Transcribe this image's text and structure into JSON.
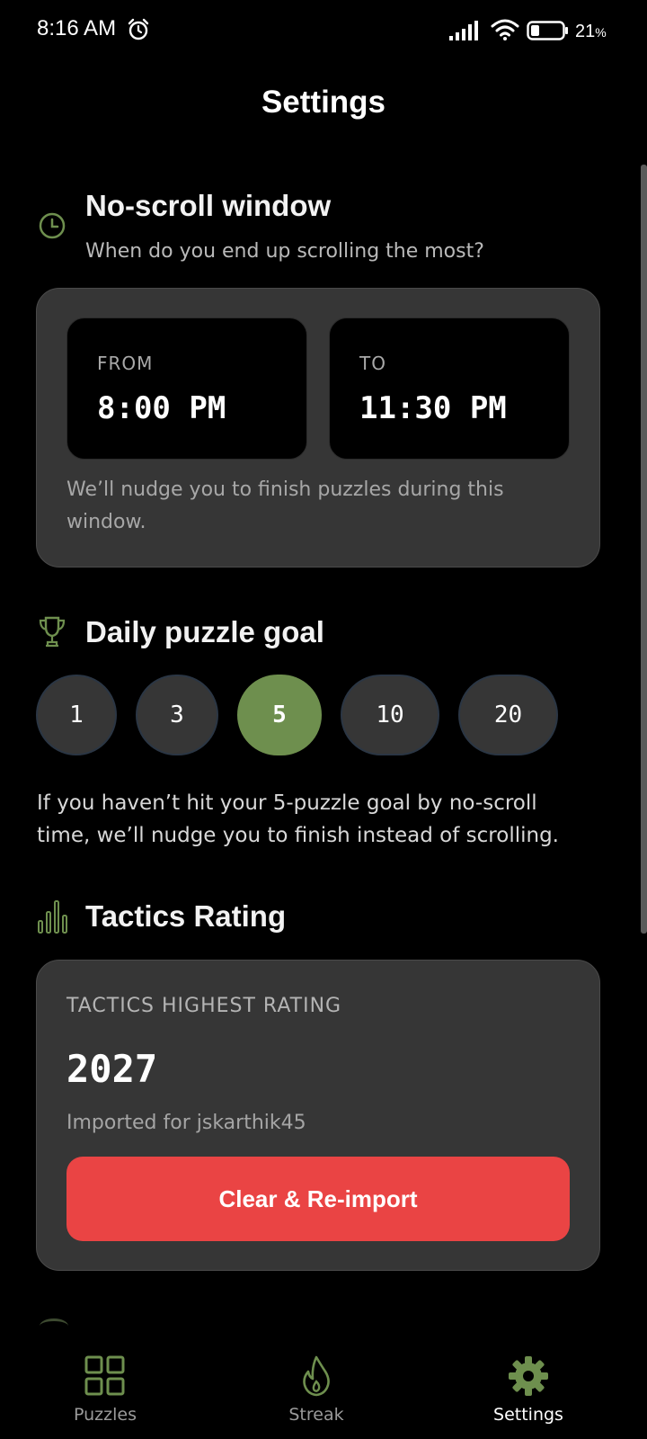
{
  "status_bar": {
    "time": "8:16 AM",
    "battery": "21",
    "battery_unit": "%"
  },
  "header": {
    "title": "Settings"
  },
  "no_scroll": {
    "title": "No-scroll window",
    "subtitle": "When do you end up scrolling the most?",
    "from_label": "FROM",
    "from_value": "8:00 PM",
    "to_label": "TO",
    "to_value": "11:30 PM",
    "note_line1": "We’ll nudge you to finish puzzles during this",
    "note_line2": "window."
  },
  "daily_goal": {
    "title": "Daily puzzle goal",
    "options": [
      "1",
      "3",
      "5",
      "10",
      "20"
    ],
    "selected": "5",
    "note_line1": "If you haven’t hit your 5-puzzle goal by no-scroll",
    "note_line2": "time, we’ll nudge you to finish instead of scrolling."
  },
  "tactics": {
    "title": "Tactics Rating",
    "label": "TACTICS HIGHEST RATING",
    "value": "2027",
    "imported_for": "Imported for jskarthik45",
    "button_label": "Clear & Re-import"
  },
  "bottom_nav": {
    "items": [
      {
        "label": "Puzzles",
        "icon": "grid-icon"
      },
      {
        "label": "Streak",
        "icon": "flame-icon"
      },
      {
        "label": "Settings",
        "icon": "gear-icon",
        "active": true
      }
    ]
  },
  "colors": {
    "accent_green": "#6e8f4e",
    "danger_red": "#ea4444",
    "card_bg": "#363636"
  }
}
